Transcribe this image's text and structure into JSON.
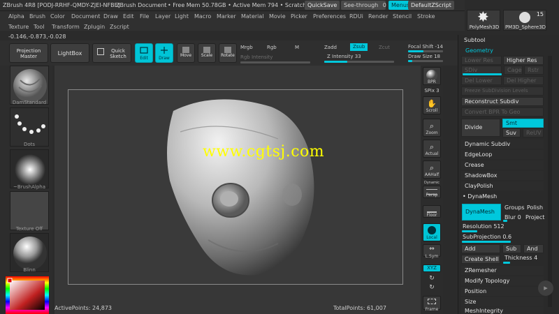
{
  "titlebar": {
    "app": "ZBrush 4R8 [PODJ-RRHF-QMDY-ZJEI-NFBE]",
    "document": "ZBrush Document",
    "free_mem": "• Free Mem 50.78GB • Active Mem 794 • Scratch Disk",
    "quicksave": "QuickSave",
    "see_through": "See-through",
    "see_through_value": "0",
    "menus": "Menus",
    "default_zscript": "DefaultZScript"
  },
  "menus": {
    "row1": [
      "Alpha",
      "Brush",
      "Color",
      "Document",
      "Draw",
      "Edit",
      "File",
      "Layer",
      "Light",
      "Macro",
      "Marker",
      "Material",
      "Movie",
      "Picker",
      "Preferences",
      "RDUi",
      "Render",
      "Stencil",
      "Stroke"
    ],
    "row2": [
      "Texture",
      "Tool",
      "Transform",
      "Zplugin",
      "Zscript"
    ]
  },
  "coords": "-0.146,-0.873,-0.028",
  "toolbar": {
    "projection_master": "Projection Master",
    "lightbox": "LightBox",
    "quick_sketch": "Quick Sketch",
    "edit": "Edit",
    "draw": "Draw",
    "move": "Move",
    "scale": "Scale",
    "rotate": "Rotate",
    "mrgb": "Mrgb",
    "rgb": "Rgb",
    "m": "M",
    "zadd": "Zadd",
    "zsub": "Zsub",
    "zcut": "Zcut",
    "rgb_intensity": "Rgb Intensity",
    "z_intensity": "Z Intensity 33",
    "focal_shift": "Focal Shift -14",
    "draw_size": "Draw Size 18"
  },
  "leftshelf": {
    "brush": "DamStandard",
    "stroke": "Dots",
    "alpha": "~BrushAlpha",
    "texture": "Texture Off",
    "material": "Blinn"
  },
  "canvas": {
    "watermark": "www.cgtsj.com",
    "active_points": "ActivePoints: 24,873",
    "total_points": "TotalPoints: 61,007"
  },
  "rightshelf": {
    "bpr": "BPR",
    "spix": "SPix 3",
    "scroll": "Scroll",
    "zoom": "Zoom",
    "actual": "Actual",
    "aahalf": "AAHalf",
    "dynamic": "Dynamic",
    "persp": "Persp",
    "floor": "Floor",
    "local": "Local",
    "lsym": "L.Sym",
    "xyz": "XYZ",
    "frame": "Frame"
  },
  "tools": {
    "polymesh": "PolyMesh3D",
    "sphere": "PM3D_Sphere3D",
    "count": "15"
  },
  "panel": {
    "subtool": "Subtool",
    "geometry": "Geometry",
    "lower_res": "Lower Res",
    "higher_res": "Higher Res",
    "sdiv": "SDiv",
    "cage": "Cage",
    "rstr": "Rstr",
    "del_lower": "Del Lower",
    "del_higher": "Del Higher",
    "freeze_subdiv": "Freeze SubDivision Levels",
    "reconstruct": "Reconstruct Subdiv",
    "convert_bpr": "Convert BPR To Geo",
    "divide": "Divide",
    "smt": "Smt",
    "suv": "Suv",
    "reuv": "ReUV",
    "dynamic_subdiv": "Dynamic Subdiv",
    "edgeloop": "EdgeLoop",
    "crease": "Crease",
    "shadowbox": "ShadowBox",
    "claypolish": "ClayPolish",
    "dynamesh_hdr": "DynaMesh",
    "dynamesh_btn": "DynaMesh",
    "groups": "Groups",
    "polish": "Polish",
    "blur": "Blur 0",
    "project": "Project",
    "resolution": "Resolution 512",
    "subprojection": "SubProjection 0.6",
    "add": "Add",
    "sub": "Sub",
    "and": "And",
    "create_shell": "Create Shell",
    "thickness": "Thickness 4",
    "zremesher": "ZRemesher",
    "modify_topology": "Modify Topology",
    "position": "Position",
    "size": "Size",
    "meshintegrity": "MeshIntegrity"
  },
  "colors": {
    "accent": "#00c8dc",
    "background": "#2b2b2b",
    "watermark": "#ffff00"
  }
}
